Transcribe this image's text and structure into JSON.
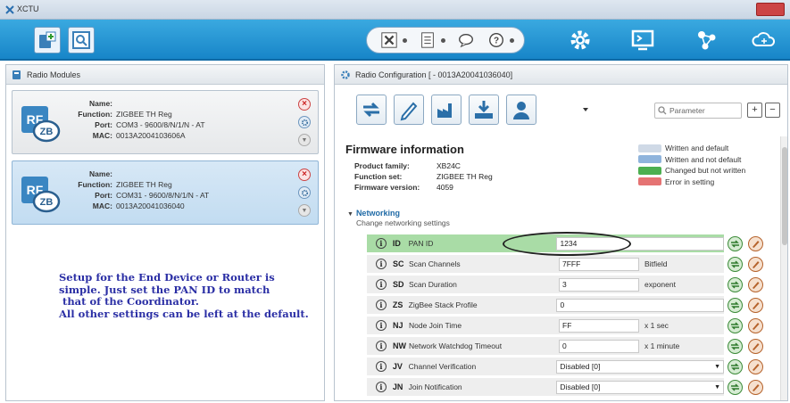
{
  "window": {
    "title": "XCTU"
  },
  "left_panel": {
    "header": "Radio Modules",
    "modules": [
      {
        "name_label": "Name:",
        "name": "",
        "function_label": "Function:",
        "function": "ZIGBEE TH Reg",
        "port_label": "Port:",
        "port": "COM3 - 9600/8/N/1/N - AT",
        "mac_label": "MAC:",
        "mac": "0013A2004103606A",
        "icon_text_top": "RF",
        "icon_text_bottom": "ZB"
      },
      {
        "name_label": "Name:",
        "name": "",
        "function_label": "Function:",
        "function": "ZIGBEE TH Reg",
        "port_label": "Port:",
        "port": "COM31 - 9600/8/N/1/N - AT",
        "mac_label": "MAC:",
        "mac": "0013A20041036040",
        "icon_text_top": "RF",
        "icon_text_bottom": "ZB"
      }
    ]
  },
  "annotation": {
    "lines": [
      "Setup for the End Device or Router is",
      "simple. Just set the PAN ID to match",
      " that of the Coordinator.",
      "All other settings can be left at the default."
    ]
  },
  "right_panel": {
    "header": "Radio Configuration [ - 0013A20041036040]",
    "search_placeholder": "Parameter",
    "firmware": {
      "title": "Firmware information",
      "rows": [
        {
          "label": "Product family:",
          "value": "XB24C"
        },
        {
          "label": "Function set:",
          "value": "ZIGBEE TH Reg"
        },
        {
          "label": "Firmware version:",
          "value": "4059"
        }
      ]
    },
    "legend": [
      {
        "label": "Written and default",
        "color": "#cfd9e6"
      },
      {
        "label": "Written and not default",
        "color": "#8fb4dc"
      },
      {
        "label": "Changed but not written",
        "color": "#4caf50"
      },
      {
        "label": "Error in setting",
        "color": "#e57373"
      }
    ],
    "section": {
      "name": "Networking",
      "description": "Change networking settings"
    },
    "settings": [
      {
        "code": "ID",
        "label": "PAN ID",
        "value": "1234",
        "unit": "",
        "kind": "text"
      },
      {
        "code": "SC",
        "label": "Scan Channels",
        "value": "7FFF",
        "unit": "Bitfield",
        "kind": "text"
      },
      {
        "code": "SD",
        "label": "Scan Duration",
        "value": "3",
        "unit": "exponent",
        "kind": "text"
      },
      {
        "code": "ZS",
        "label": "ZigBee Stack Profile",
        "value": "0",
        "unit": "",
        "kind": "text"
      },
      {
        "code": "NJ",
        "label": "Node Join Time",
        "value": "FF",
        "unit": "x 1 sec",
        "kind": "text"
      },
      {
        "code": "NW",
        "label": "Network Watchdog Timeout",
        "value": "0",
        "unit": "x 1 minute",
        "kind": "text"
      },
      {
        "code": "JV",
        "label": "Channel Verification",
        "value": "Disabled [0]",
        "unit": "",
        "kind": "select"
      },
      {
        "code": "JN",
        "label": "Join Notification",
        "value": "Disabled [0]",
        "unit": "",
        "kind": "select"
      }
    ]
  },
  "colors": {
    "toolbar": "#1f8fd0",
    "highlight_row": "#a9dca6",
    "annotation_text": "#2b2fa5"
  }
}
